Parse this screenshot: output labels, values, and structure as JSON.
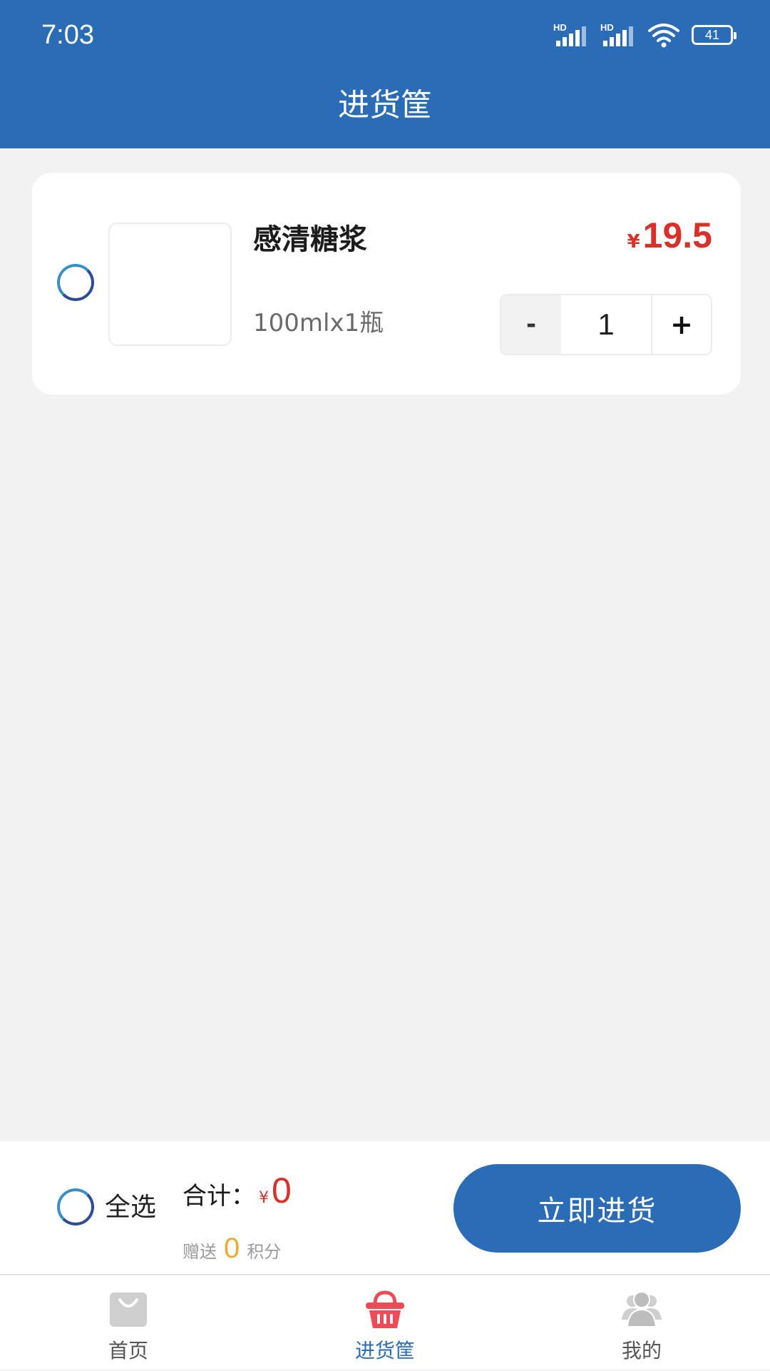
{
  "status_bar": {
    "time": "7:03",
    "battery": "41",
    "signal1_label": "HD",
    "signal2_label": "HD"
  },
  "header": {
    "title": "进货筐"
  },
  "cart": {
    "items": [
      {
        "name": "感清糖浆",
        "spec": "100mlx1瓶",
        "currency": "¥",
        "price": "19.5",
        "quantity": "1",
        "minus_label": "-",
        "plus_label": "+"
      }
    ]
  },
  "checkout": {
    "select_all_label": "全选",
    "total_label": "合计：",
    "currency": "¥",
    "total_value": "0",
    "points_prefix": "赠送",
    "points_value": "0",
    "points_suffix": "积分",
    "purchase_button_label": "立即进货"
  },
  "tabs": [
    {
      "label": "首页",
      "icon": "shopping-bag-icon",
      "active": false
    },
    {
      "label": "进货筐",
      "icon": "basket-icon",
      "active": true
    },
    {
      "label": "我的",
      "icon": "users-icon",
      "active": false
    }
  ],
  "colors": {
    "brand": "#2a6db6",
    "price": "#d8312a",
    "points": "#f0a832",
    "active_tab_icon": "#ee4b57",
    "inactive_tab_icon": "#cfcfcf"
  }
}
